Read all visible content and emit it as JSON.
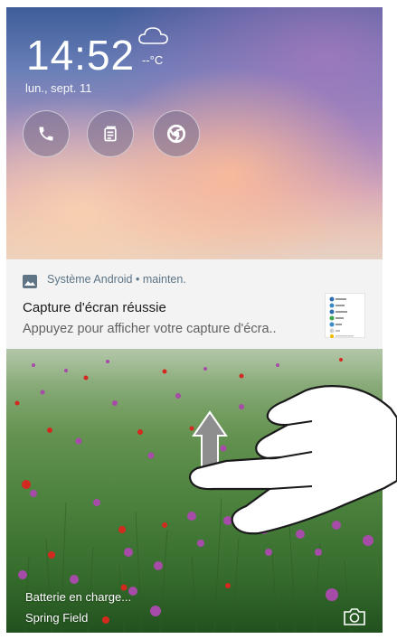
{
  "lockscreen": {
    "time": "14:52",
    "temperature": "--°C",
    "date": "lun., sept. 11",
    "weather_icon": "cloud-icon",
    "shortcuts": [
      {
        "name": "phone",
        "icon": "phone-icon"
      },
      {
        "name": "notes",
        "icon": "notes-icon"
      },
      {
        "name": "chrome",
        "icon": "chrome-icon"
      }
    ]
  },
  "notification": {
    "app": "Système Android",
    "separator": "•",
    "time": "mainten.",
    "title": "Capture d'écran réussie",
    "body": "Appuyez pour afficher votre capture d'écra..",
    "app_icon": "image-icon"
  },
  "status": {
    "charging": "Batterie en charge...",
    "wallpaper_name": "Spring Field",
    "camera_icon": "camera-icon"
  },
  "gesture": {
    "icon": "swipe-up-hand-icon",
    "direction": "up"
  },
  "colors": {
    "notification_bg": "#f3f3f3",
    "notification_header": "#5b7486",
    "text_white": "#ffffff"
  }
}
